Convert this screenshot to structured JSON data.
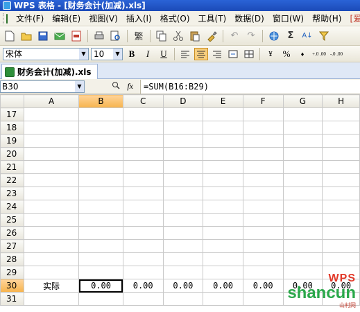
{
  "window": {
    "title": "WPS 表格 - [财务会计(加减).xls]"
  },
  "menu": [
    "文件(F)",
    "编辑(E)",
    "视图(V)",
    "插入(I)",
    "格式(O)",
    "工具(T)",
    "数据(D)",
    "窗口(W)",
    "帮助(H)",
    "[爱"
  ],
  "toolbar": {
    "icons": [
      "new-icon",
      "open-icon",
      "save-icon",
      "email-icon",
      "pdf-icon",
      "print-icon",
      "print-preview-icon",
      "traditional-chinese-icon",
      "copy-icon",
      "cut-icon",
      "paste-icon",
      "format-painter-icon",
      "undo-icon",
      "redo-icon",
      "hyperlink-icon",
      "sum-icon",
      "sort-ascending-icon",
      "filter-icon"
    ],
    "traditional_label": "繁",
    "sum_label": "Σ"
  },
  "format": {
    "font": "宋体",
    "size": "10",
    "bold": "B",
    "italic": "I",
    "underline": "U",
    "percent": "%",
    "comma": "♦",
    "inc_decimal": "+.0 .00",
    "dec_decimal": "-.0 .00"
  },
  "doc_tab": {
    "label": "财务会计(加减).xls"
  },
  "formula_bar": {
    "cell_ref": "B30",
    "fx": "fx",
    "formula": "=SUM(B16:B29)"
  },
  "columns": [
    "A",
    "B",
    "C",
    "D",
    "E",
    "F",
    "G",
    "H"
  ],
  "active_column": "B",
  "active_row": "30",
  "rows": [
    {
      "num": "17",
      "cells": [
        "",
        "",
        "",
        "",
        "",
        "",
        "",
        ""
      ]
    },
    {
      "num": "18",
      "cells": [
        "",
        "",
        "",
        "",
        "",
        "",
        "",
        ""
      ]
    },
    {
      "num": "19",
      "cells": [
        "",
        "",
        "",
        "",
        "",
        "",
        "",
        ""
      ]
    },
    {
      "num": "20",
      "cells": [
        "",
        "",
        "",
        "",
        "",
        "",
        "",
        ""
      ]
    },
    {
      "num": "21",
      "cells": [
        "",
        "",
        "",
        "",
        "",
        "",
        "",
        ""
      ]
    },
    {
      "num": "22",
      "cells": [
        "",
        "",
        "",
        "",
        "",
        "",
        "",
        ""
      ]
    },
    {
      "num": "23",
      "cells": [
        "",
        "",
        "",
        "",
        "",
        "",
        "",
        ""
      ]
    },
    {
      "num": "24",
      "cells": [
        "",
        "",
        "",
        "",
        "",
        "",
        "",
        ""
      ]
    },
    {
      "num": "25",
      "cells": [
        "",
        "",
        "",
        "",
        "",
        "",
        "",
        ""
      ]
    },
    {
      "num": "26",
      "cells": [
        "",
        "",
        "",
        "",
        "",
        "",
        "",
        ""
      ]
    },
    {
      "num": "27",
      "cells": [
        "",
        "",
        "",
        "",
        "",
        "",
        "",
        ""
      ]
    },
    {
      "num": "28",
      "cells": [
        "",
        "",
        "",
        "",
        "",
        "",
        "",
        ""
      ]
    },
    {
      "num": "29",
      "cells": [
        "",
        "",
        "",
        "",
        "",
        "",
        "",
        ""
      ]
    },
    {
      "num": "30",
      "cells": [
        "实际",
        "0.00",
        "0.00",
        "0.00",
        "0.00",
        "0.00",
        "0.00",
        "0.00"
      ]
    },
    {
      "num": "31",
      "cells": [
        "",
        "",
        "",
        "",
        "",
        "",
        "",
        ""
      ]
    }
  ],
  "watermark": {
    "brand": "WPS",
    "site": "shancun",
    "sub": "山村网"
  },
  "colors": {
    "titlebar": "#2a63d6",
    "active_header": "#f6b34c",
    "watermark_red": "#e23a2a",
    "watermark_green": "#2aa84a"
  }
}
